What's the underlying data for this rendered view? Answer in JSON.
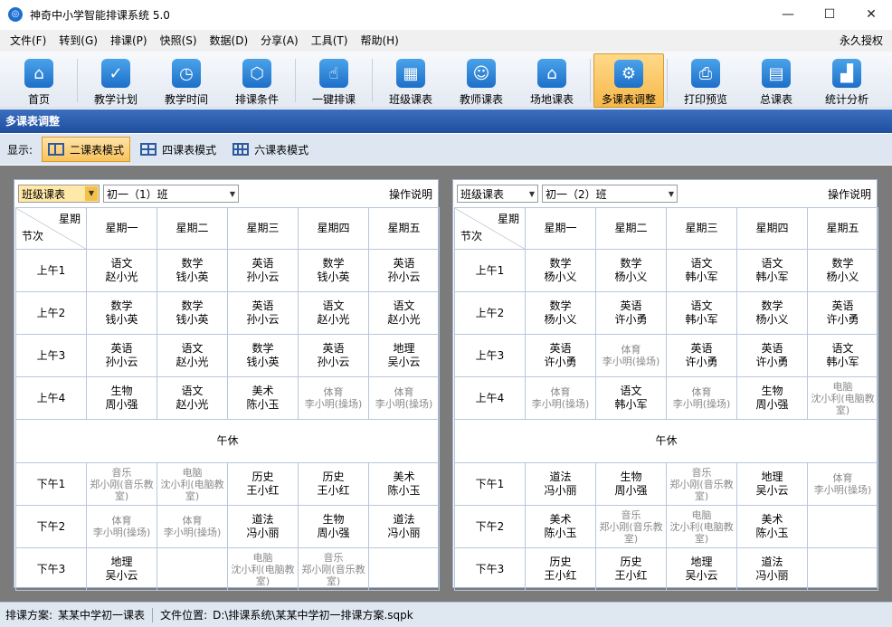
{
  "window": {
    "title": "神奇中小学智能排课系统 5.0",
    "minimize": "—",
    "maximize": "☐",
    "close": "✕"
  },
  "menu": {
    "items": [
      "文件(F)",
      "转到(G)",
      "排课(P)",
      "快照(S)",
      "数据(D)",
      "分享(A)",
      "工具(T)",
      "帮助(H)"
    ],
    "license": "永久授权"
  },
  "toolbar": {
    "items": [
      {
        "label": "首页",
        "icon": "home-icon",
        "glyph": "⌂"
      },
      {
        "label": "教学计划",
        "icon": "clipboard-icon",
        "glyph": "✓"
      },
      {
        "label": "教学时间",
        "icon": "clock-icon",
        "glyph": "◷"
      },
      {
        "label": "排课条件",
        "icon": "cubes-icon",
        "glyph": "⬡"
      },
      {
        "label": "一键排课",
        "icon": "pointer-icon",
        "glyph": "☝"
      },
      {
        "label": "班级课表",
        "icon": "calendar-icon",
        "glyph": "▦"
      },
      {
        "label": "教师课表",
        "icon": "teacher-card-icon",
        "glyph": "☺"
      },
      {
        "label": "场地课表",
        "icon": "building-icon",
        "glyph": "⌂"
      },
      {
        "label": "多课表调整",
        "icon": "multi-schedule-icon",
        "glyph": "⚙"
      },
      {
        "label": "打印预览",
        "icon": "printer-icon",
        "glyph": "⎙"
      },
      {
        "label": "总课表",
        "icon": "master-schedule-icon",
        "glyph": "▤"
      },
      {
        "label": "统计分析",
        "icon": "chart-icon",
        "glyph": "▟"
      }
    ]
  },
  "section": {
    "title": "多课表调整"
  },
  "modes": {
    "label": "显示:",
    "two": "二课表模式",
    "four": "四课表模式",
    "six": "六课表模式"
  },
  "panels": [
    {
      "type": "班级课表",
      "class": "初一（1）班",
      "help": "操作说明",
      "corner_top": "星期",
      "corner_bottom": "节次",
      "days": [
        "星期一",
        "星期二",
        "星期三",
        "星期四",
        "星期五"
      ],
      "noon": "午休",
      "periods": [
        {
          "label": "上午1",
          "cells": [
            {
              "s": "语文",
              "t": "赵小光"
            },
            {
              "s": "数学",
              "t": "钱小英"
            },
            {
              "s": "英语",
              "t": "孙小云"
            },
            {
              "s": "数学",
              "t": "钱小英"
            },
            {
              "s": "英语",
              "t": "孙小云"
            }
          ]
        },
        {
          "label": "上午2",
          "cells": [
            {
              "s": "数学",
              "t": "钱小英"
            },
            {
              "s": "数学",
              "t": "钱小英"
            },
            {
              "s": "英语",
              "t": "孙小云"
            },
            {
              "s": "语文",
              "t": "赵小光"
            },
            {
              "s": "语文",
              "t": "赵小光"
            }
          ]
        },
        {
          "label": "上午3",
          "cells": [
            {
              "s": "英语",
              "t": "孙小云"
            },
            {
              "s": "语文",
              "t": "赵小光"
            },
            {
              "s": "数学",
              "t": "钱小英"
            },
            {
              "s": "英语",
              "t": "孙小云"
            },
            {
              "s": "地理",
              "t": "吴小云"
            }
          ]
        },
        {
          "label": "上午4",
          "cells": [
            {
              "s": "生物",
              "t": "周小强"
            },
            {
              "s": "语文",
              "t": "赵小光"
            },
            {
              "s": "美术",
              "t": "陈小玉"
            },
            {
              "s": "体育",
              "t": "李小明(操场)",
              "g": true
            },
            {
              "s": "体育",
              "t": "李小明(操场)",
              "g": true
            }
          ]
        },
        {
          "label": "下午1",
          "cells": [
            {
              "s": "音乐",
              "t": "郑小刚(音乐教室)",
              "g": true
            },
            {
              "s": "电脑",
              "t": "沈小利(电脑教室)",
              "g": true
            },
            {
              "s": "历史",
              "t": "王小红"
            },
            {
              "s": "历史",
              "t": "王小红"
            },
            {
              "s": "美术",
              "t": "陈小玉"
            }
          ]
        },
        {
          "label": "下午2",
          "cells": [
            {
              "s": "体育",
              "t": "李小明(操场)",
              "g": true
            },
            {
              "s": "体育",
              "t": "李小明(操场)",
              "g": true
            },
            {
              "s": "道法",
              "t": "冯小丽"
            },
            {
              "s": "生物",
              "t": "周小强"
            },
            {
              "s": "道法",
              "t": "冯小丽"
            }
          ]
        },
        {
          "label": "下午3",
          "cells": [
            {
              "s": "地理",
              "t": "吴小云"
            },
            {
              "s": "",
              "t": ""
            },
            {
              "s": "电脑",
              "t": "沈小利(电脑教室)",
              "g": true
            },
            {
              "s": "音乐",
              "t": "郑小刚(音乐教室)",
              "g": true
            },
            {
              "s": "",
              "t": ""
            }
          ]
        }
      ]
    },
    {
      "type": "班级课表",
      "class": "初一（2）班",
      "help": "操作说明",
      "corner_top": "星期",
      "corner_bottom": "节次",
      "days": [
        "星期一",
        "星期二",
        "星期三",
        "星期四",
        "星期五"
      ],
      "noon": "午休",
      "periods": [
        {
          "label": "上午1",
          "cells": [
            {
              "s": "数学",
              "t": "杨小义"
            },
            {
              "s": "数学",
              "t": "杨小义"
            },
            {
              "s": "语文",
              "t": "韩小军"
            },
            {
              "s": "语文",
              "t": "韩小军"
            },
            {
              "s": "数学",
              "t": "杨小义"
            }
          ]
        },
        {
          "label": "上午2",
          "cells": [
            {
              "s": "数学",
              "t": "杨小义"
            },
            {
              "s": "英语",
              "t": "许小勇"
            },
            {
              "s": "语文",
              "t": "韩小军"
            },
            {
              "s": "数学",
              "t": "杨小义"
            },
            {
              "s": "英语",
              "t": "许小勇"
            }
          ]
        },
        {
          "label": "上午3",
          "cells": [
            {
              "s": "英语",
              "t": "许小勇"
            },
            {
              "s": "体育",
              "t": "李小明(操场)",
              "g": true
            },
            {
              "s": "英语",
              "t": "许小勇"
            },
            {
              "s": "英语",
              "t": "许小勇"
            },
            {
              "s": "语文",
              "t": "韩小军"
            }
          ]
        },
        {
          "label": "上午4",
          "cells": [
            {
              "s": "体育",
              "t": "李小明(操场)",
              "g": true
            },
            {
              "s": "语文",
              "t": "韩小军"
            },
            {
              "s": "体育",
              "t": "李小明(操场)",
              "g": true
            },
            {
              "s": "生物",
              "t": "周小强"
            },
            {
              "s": "电脑",
              "t": "沈小利(电脑教室)",
              "g": true
            }
          ]
        },
        {
          "label": "下午1",
          "cells": [
            {
              "s": "道法",
              "t": "冯小丽"
            },
            {
              "s": "生物",
              "t": "周小强"
            },
            {
              "s": "音乐",
              "t": "郑小刚(音乐教室)",
              "g": true
            },
            {
              "s": "地理",
              "t": "吴小云"
            },
            {
              "s": "体育",
              "t": "李小明(操场)",
              "g": true
            }
          ]
        },
        {
          "label": "下午2",
          "cells": [
            {
              "s": "美术",
              "t": "陈小玉"
            },
            {
              "s": "音乐",
              "t": "郑小刚(音乐教室)",
              "g": true
            },
            {
              "s": "电脑",
              "t": "沈小利(电脑教室)",
              "g": true
            },
            {
              "s": "美术",
              "t": "陈小玉"
            },
            {
              "s": "",
              "t": ""
            }
          ]
        },
        {
          "label": "下午3",
          "cells": [
            {
              "s": "历史",
              "t": "王小红"
            },
            {
              "s": "历史",
              "t": "王小红"
            },
            {
              "s": "地理",
              "t": "吴小云"
            },
            {
              "s": "道法",
              "t": "冯小丽"
            },
            {
              "s": "",
              "t": ""
            }
          ]
        }
      ]
    }
  ],
  "status": {
    "plan_label": "排课方案:",
    "plan_value": "某某中学初一课表",
    "file_label": "文件位置:",
    "file_value": "D:\\排课系统\\某某中学初一排课方案.sqpk"
  }
}
